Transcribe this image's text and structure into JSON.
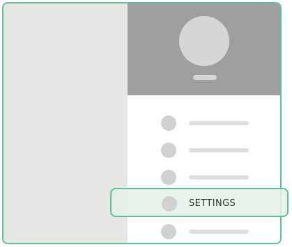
{
  "drawer": {
    "menu_items": [
      {
        "icon": "placeholder-circle-icon",
        "label": ""
      },
      {
        "icon": "placeholder-circle-icon",
        "label": ""
      },
      {
        "icon": "placeholder-circle-icon",
        "label": ""
      },
      {
        "icon": "placeholder-circle-icon",
        "label": "SETTINGS",
        "highlighted": true
      },
      {
        "icon": "placeholder-circle-icon",
        "label": ""
      }
    ]
  },
  "colors": {
    "accent": "#5fbf96",
    "left_panel": "#e7e8e6",
    "header": "#9f9f9f",
    "highlight_fill": "#e4f1e9"
  }
}
